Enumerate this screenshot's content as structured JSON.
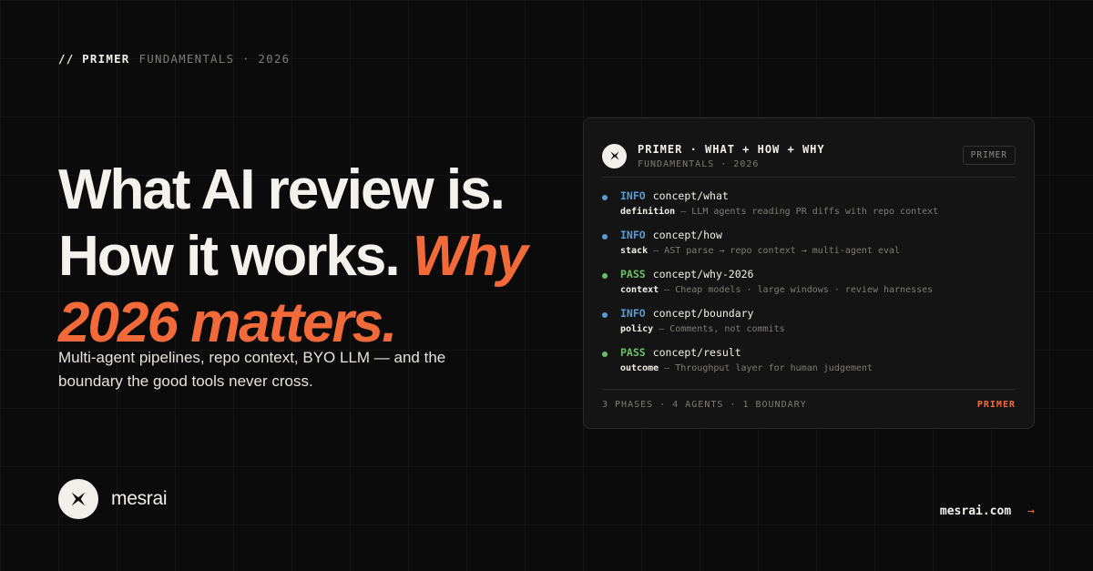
{
  "eyebrow": {
    "prefix": "// PRIMER",
    "meta": "FUNDAMENTALS · 2026"
  },
  "headline": {
    "line1": "What AI review is.",
    "line2_plain": "How it works.",
    "line2_accent": "Why",
    "line3_accent": "2026 matters."
  },
  "subhead": "Multi-agent pipelines, repo context, BYO LLM — and the boundary the good tools never cross.",
  "brand": {
    "name": "mesrai",
    "logo_icon": "bowtie-x-icon"
  },
  "site": {
    "url": "mesrai.com",
    "arrow": "→"
  },
  "card": {
    "title": "PRIMER · WHAT + HOW + WHY",
    "subtitle": "FUNDAMENTALS · 2026",
    "badge": "PRIMER",
    "rows": [
      {
        "status": "INFO",
        "path": "concept/what",
        "key": "definition",
        "sep": " — ",
        "desc": "LLM agents reading PR diffs with repo context",
        "color": "#5b9bd5"
      },
      {
        "status": "INFO",
        "path": "concept/how",
        "key": "stack",
        "sep": " — ",
        "desc": "AST parse → repo context → multi-agent eval",
        "color": "#5b9bd5"
      },
      {
        "status": "PASS",
        "path": "concept/why-2026",
        "key": "context",
        "sep": " — ",
        "desc": "Cheap models · large windows · review harnesses",
        "color": "#6cbf6a"
      },
      {
        "status": "INFO",
        "path": "concept/boundary",
        "key": "policy",
        "sep": " — ",
        "desc": "Comments, not commits",
        "color": "#5b9bd5"
      },
      {
        "status": "PASS",
        "path": "concept/result",
        "key": "outcome",
        "sep": " — ",
        "desc": "Throughput layer for human judgement",
        "color": "#6cbf6a"
      }
    ],
    "footer_stats": "3 PHASES · 4 AGENTS · 1 BOUNDARY",
    "footer_tag": "PRIMER"
  },
  "colors": {
    "accent": "#f26a3a",
    "info": "#5b9bd5",
    "pass": "#6cbf6a",
    "background": "#0b0b0b"
  }
}
